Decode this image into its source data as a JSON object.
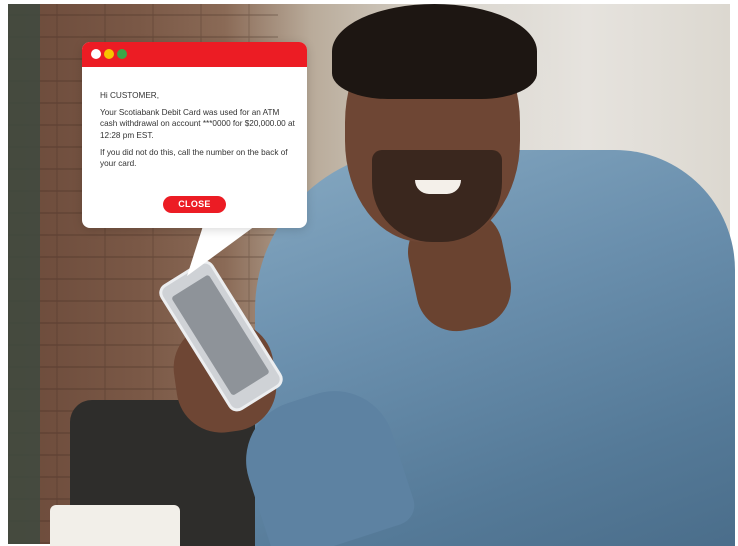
{
  "popup": {
    "greeting": "Hi CUSTOMER,",
    "message_1": "Your Scotiabank Debit Card was used for an ATM cash withdrawal on account ***0000 for $20,000.00 at 12:28 pm EST.",
    "message_2": "If you did not do this, call the number on the back of your card.",
    "close_label": "CLOSE",
    "colors": {
      "header": "#ec1c24",
      "button": "#ec1c24",
      "dot_1": "#ffffff",
      "dot_2": "#f7c500",
      "dot_3": "#3aa548"
    }
  }
}
